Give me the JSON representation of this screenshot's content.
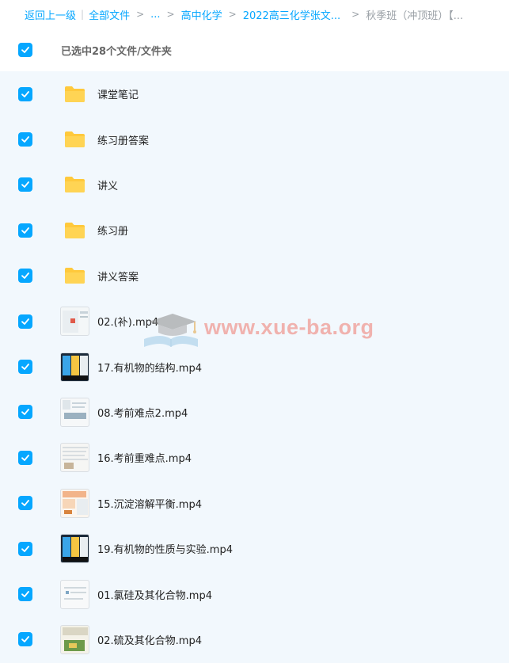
{
  "breadcrumb": {
    "back": "返回上一级",
    "all": "全部文件",
    "ellipsis": "...",
    "level1": "高中化学",
    "level2": "2022高三化学张文...",
    "current": "秋季班（冲顶班）【..."
  },
  "selection": {
    "label": "已选中28个文件/文件夹"
  },
  "colors": {
    "accent": "#06a7ff",
    "folder": "#ffc93c",
    "list_bg": "#f2f8fd"
  },
  "items": [
    {
      "type": "folder",
      "name": "课堂笔记",
      "icon": "folder-icon"
    },
    {
      "type": "folder",
      "name": "练习册答案",
      "icon": "folder-icon"
    },
    {
      "type": "folder",
      "name": "讲义",
      "icon": "folder-icon"
    },
    {
      "type": "folder",
      "name": "练习册",
      "icon": "folder-icon"
    },
    {
      "type": "folder",
      "name": "讲义答案",
      "icon": "folder-icon"
    },
    {
      "type": "video",
      "name": "02.(补).mp4",
      "icon": "video-thumbnail"
    },
    {
      "type": "video",
      "name": "17.有机物的结构.mp4",
      "icon": "video-thumbnail"
    },
    {
      "type": "video",
      "name": "08.考前难点2.mp4",
      "icon": "video-thumbnail"
    },
    {
      "type": "video",
      "name": "16.考前重难点.mp4",
      "icon": "video-thumbnail"
    },
    {
      "type": "video",
      "name": "15.沉淀溶解平衡.mp4",
      "icon": "video-thumbnail"
    },
    {
      "type": "video",
      "name": "19.有机物的性质与实验.mp4",
      "icon": "video-thumbnail"
    },
    {
      "type": "video",
      "name": "01.氯硅及其化合物.mp4",
      "icon": "video-thumbnail"
    },
    {
      "type": "video",
      "name": "02.硫及其化合物.mp4",
      "icon": "video-thumbnail"
    }
  ],
  "watermark": {
    "text": "www.xue-ba.org"
  }
}
